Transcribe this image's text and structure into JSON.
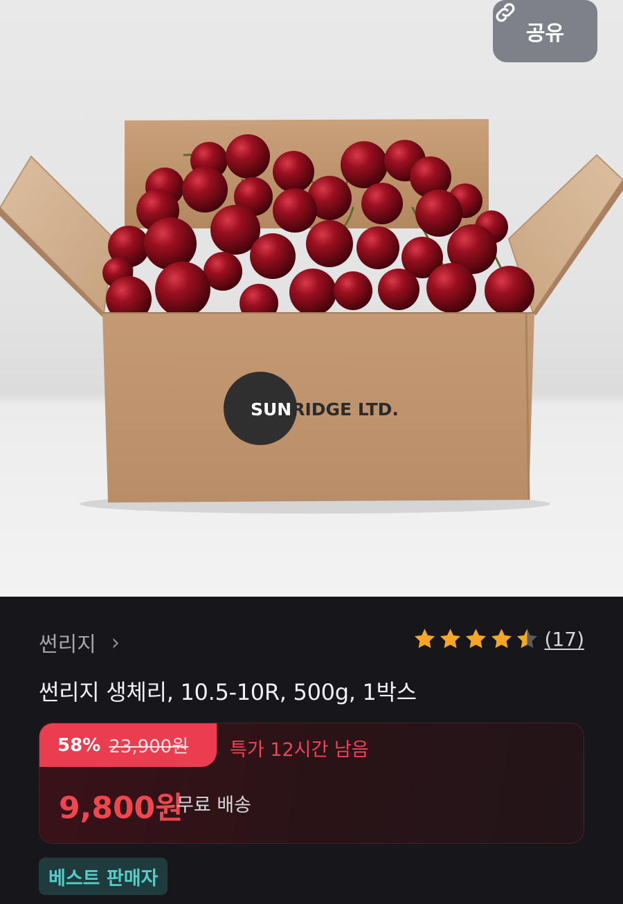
{
  "header": {
    "share_label": "공유",
    "share_icon": "link-icon"
  },
  "hero": {
    "box_logo_text": "SUNRIDGE LTD."
  },
  "product": {
    "brand": "썬리지",
    "brand_chevron": "›",
    "title": "썬리지 생체리, 10.5-10R, 500g, 1박스",
    "rating": {
      "stars": 4.5,
      "max": 5,
      "count": "(17)"
    },
    "pricing": {
      "discount_rate": "58%",
      "original_price": "23,900원",
      "deal_text": "특가 12시간 남음",
      "sale_price": "9,800원",
      "shipping": "무료 배송"
    },
    "badge": "베스트 판매자"
  },
  "colors": {
    "accent_red": "#ea3d50",
    "price_red": "#f0474f",
    "star_gold": "#f5a623",
    "badge_teal": "#52cfc9"
  }
}
